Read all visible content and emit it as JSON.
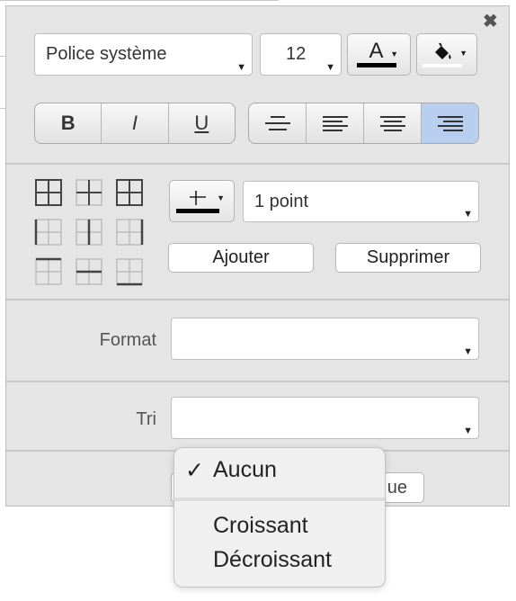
{
  "toolbar": {
    "close_icon": "close-icon",
    "font": {
      "value": "Police système"
    },
    "font_size": {
      "value": "12"
    },
    "text_color": {
      "letter": "A",
      "color": "#000000"
    },
    "fill_color": {
      "color": "#ffffff"
    }
  },
  "style_buttons": [
    "B",
    "I",
    "U"
  ],
  "alignment": {
    "active_index": 3,
    "items": [
      "align-center-icon",
      "align-left-icon",
      "align-center-icon",
      "align-right-icon"
    ]
  },
  "borders": {
    "line_width": {
      "value": "1 point"
    },
    "border_color": "#000000",
    "add_label": "Ajouter",
    "remove_label": "Supprimer"
  },
  "format": {
    "label": "Format",
    "value": ""
  },
  "sort": {
    "label": "Tri",
    "value": ""
  },
  "hidden_button_fragment": "ue",
  "sort_menu": {
    "check_glyph": "✓",
    "selected_index": 0,
    "options": [
      "Aucun",
      "Croissant",
      "Décroissant"
    ]
  }
}
